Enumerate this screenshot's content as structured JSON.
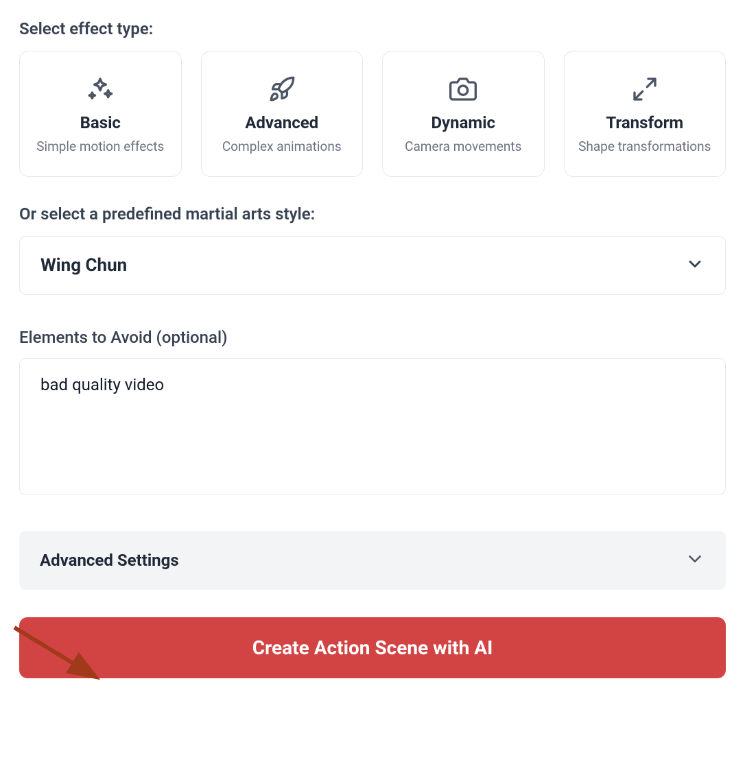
{
  "effectType": {
    "label": "Select effect type:",
    "options": [
      {
        "title": "Basic",
        "desc": "Simple motion effects",
        "icon": "sparkles"
      },
      {
        "title": "Advanced",
        "desc": "Complex animations",
        "icon": "rocket"
      },
      {
        "title": "Dynamic",
        "desc": "Camera movements",
        "icon": "camera"
      },
      {
        "title": "Transform",
        "desc": "Shape transformations",
        "icon": "maximize"
      }
    ]
  },
  "styleSelect": {
    "label": "Or select a predefined martial arts style:",
    "value": "Wing Chun"
  },
  "avoid": {
    "label": "Elements to Avoid (optional)",
    "value": "bad quality video"
  },
  "advanced": {
    "label": "Advanced Settings"
  },
  "submit": {
    "label": "Create Action Scene with AI"
  },
  "colors": {
    "primary": "#d24444",
    "border": "#e5e7eb",
    "textMuted": "#6b7280"
  }
}
